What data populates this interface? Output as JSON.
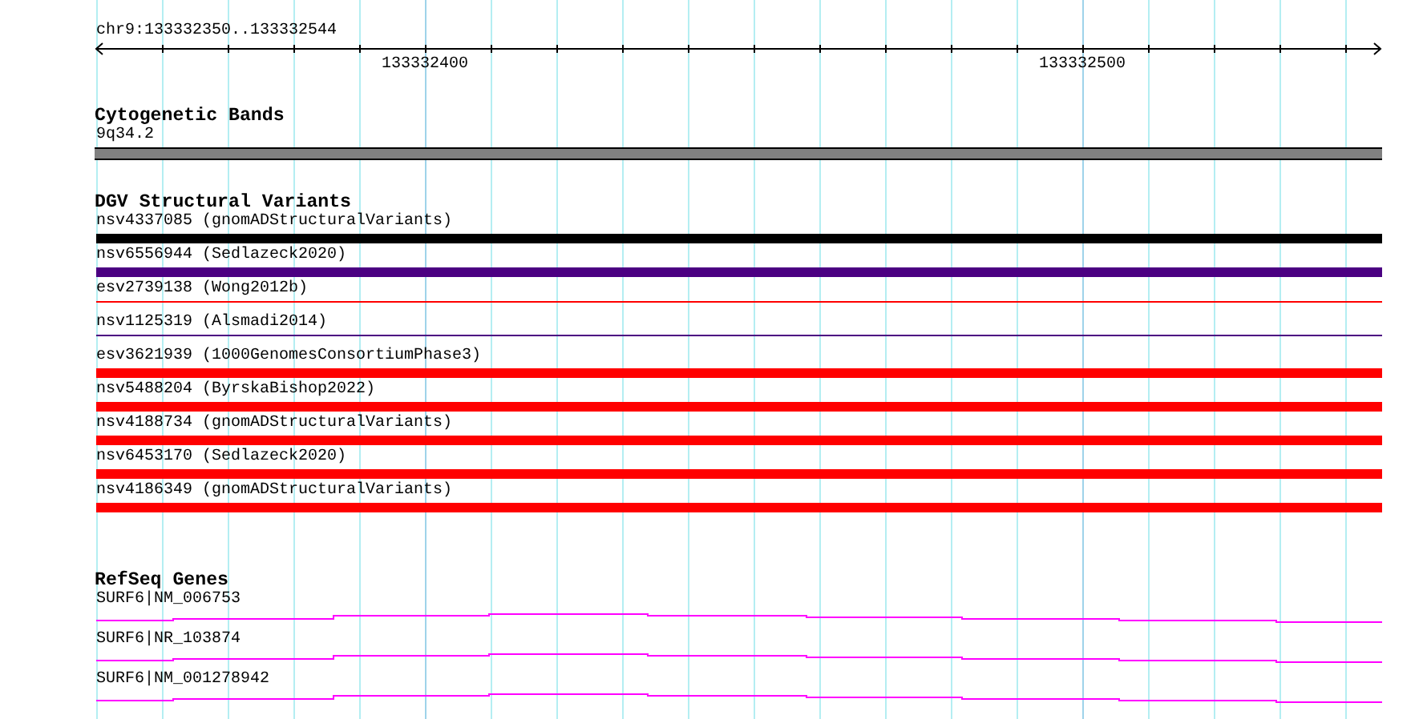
{
  "location": "chr9:133332350..133332544",
  "ruler": {
    "labels": [
      "133332400",
      "133332500"
    ]
  },
  "cytogenetic_bands": {
    "title": "Cytogenetic Bands",
    "band": "9q34.2"
  },
  "dgv_structural_variants": {
    "title": "DGV Structural Variants",
    "variants": [
      {
        "label": "nsv4337085 (gnomADStructuralVariants)",
        "kind": "thick",
        "color": "#000000"
      },
      {
        "label": "nsv6556944 (Sedlazeck2020)",
        "kind": "thick",
        "color": "#4b0082"
      },
      {
        "label": "esv2739138 (Wong2012b)",
        "kind": "thin",
        "color": "#ff0000"
      },
      {
        "label": "nsv1125319 (Alsmadi2014)",
        "kind": "thin",
        "color": "#4b0082"
      },
      {
        "label": "esv3621939 (1000GenomesConsortiumPhase3)",
        "kind": "thick",
        "color": "#ff0000"
      },
      {
        "label": "nsv5488204 (ByrskaBishop2022)",
        "kind": "thick",
        "color": "#ff0000"
      },
      {
        "label": "nsv4188734 (gnomADStructuralVariants)",
        "kind": "thick",
        "color": "#ff0000"
      },
      {
        "label": "nsv6453170 (Sedlazeck2020)",
        "kind": "thick",
        "color": "#ff0000"
      },
      {
        "label": "nsv4186349 (gnomADStructuralVariants)",
        "kind": "thick",
        "color": "#ff0000"
      }
    ]
  },
  "refseq_genes": {
    "title": "RefSeq Genes",
    "genes": [
      {
        "label": "SURF6|NM_006753"
      },
      {
        "label": "SURF6|NR_103874"
      },
      {
        "label": "SURF6|NM_001278942"
      }
    ]
  }
}
